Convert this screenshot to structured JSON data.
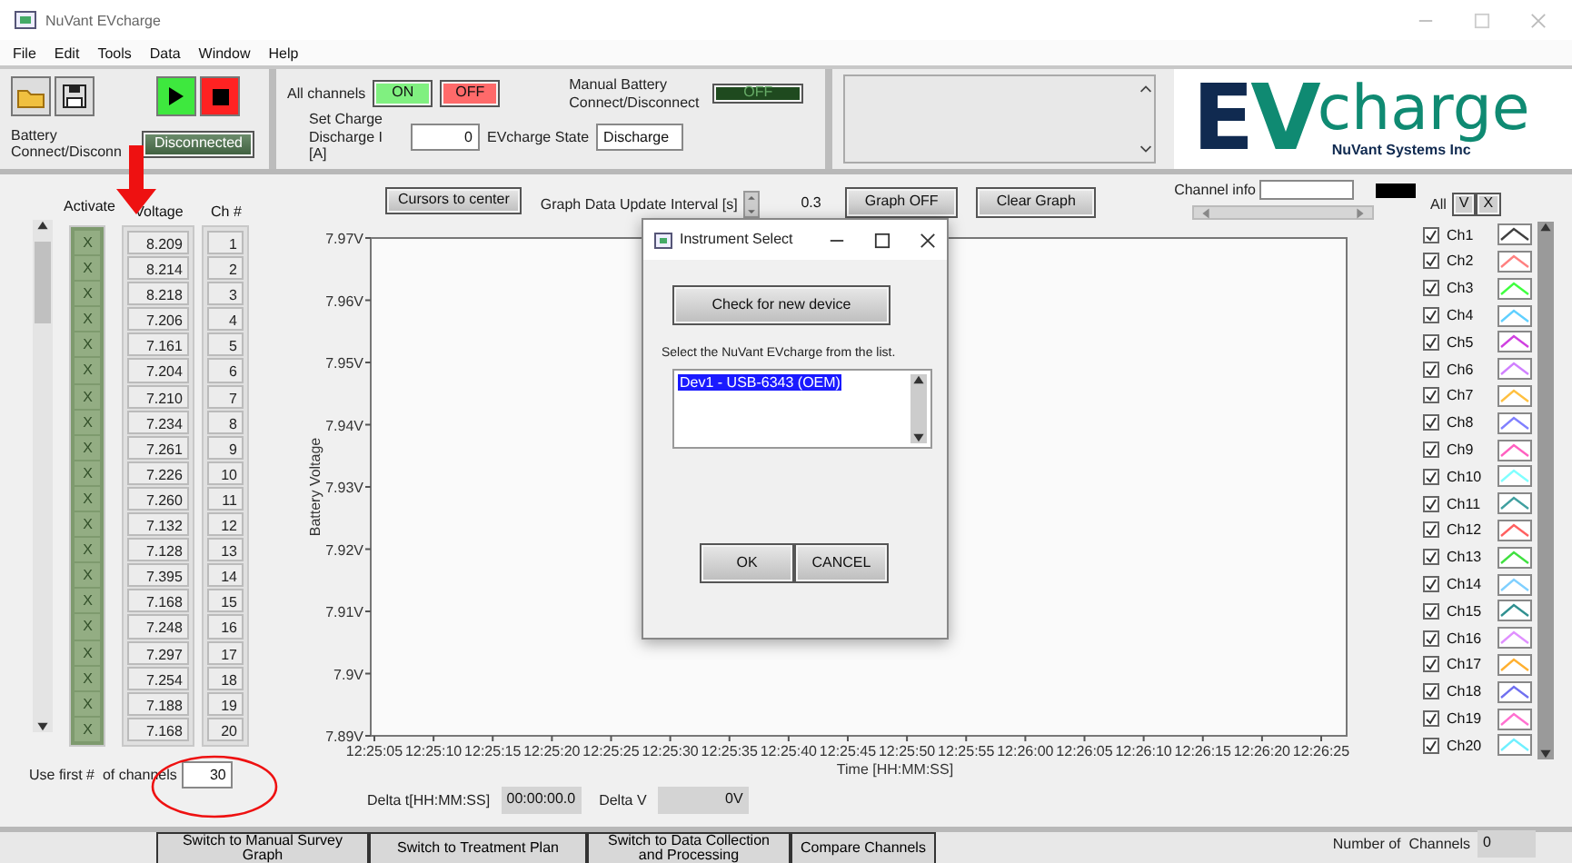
{
  "window": {
    "title": "NuVant EVcharge"
  },
  "menu": [
    "File",
    "Edit",
    "Tools",
    "Data",
    "Window",
    "Help"
  ],
  "toolbar": {
    "battery_label": "Battery Connect/Disconn",
    "connection_button": "Disconnected",
    "all_channels_label": "All channels",
    "on_button": "ON",
    "off_button": "OFF",
    "manual_label": "Manual Battery Connect/Disconnect",
    "manual_toggle": {
      "label": "OFF",
      "on": false
    },
    "charge_label": "Set Charge Discharge I [A]",
    "charge_value": "0",
    "state_label": "EVcharge State",
    "state_value": "Discharge"
  },
  "logo": {
    "parts": [
      {
        "kind": "initial",
        "text": "E",
        "color": "#102a50"
      },
      {
        "kind": "initial",
        "text": "V",
        "color": "#0f8a72"
      },
      {
        "kind": "word",
        "text": "charge",
        "color": "#0f8a72"
      }
    ],
    "subtitle": "NuVant Systems Inc"
  },
  "channel_table": {
    "columns": [
      "Activate",
      "Voltage",
      "Ch #"
    ],
    "rows": [
      {
        "activate": "X",
        "voltage": "8.209",
        "ch": "1"
      },
      {
        "activate": "X",
        "voltage": "8.214",
        "ch": "2"
      },
      {
        "activate": "X",
        "voltage": "8.218",
        "ch": "3"
      },
      {
        "activate": "X",
        "voltage": "7.206",
        "ch": "4"
      },
      {
        "activate": "X",
        "voltage": "7.161",
        "ch": "5"
      },
      {
        "activate": "X",
        "voltage": "7.204",
        "ch": "6"
      },
      {
        "activate": "X",
        "voltage": "7.210",
        "ch": "7"
      },
      {
        "activate": "X",
        "voltage": "7.234",
        "ch": "8"
      },
      {
        "activate": "X",
        "voltage": "7.261",
        "ch": "9"
      },
      {
        "activate": "X",
        "voltage": "7.226",
        "ch": "10"
      },
      {
        "activate": "X",
        "voltage": "7.260",
        "ch": "11"
      },
      {
        "activate": "X",
        "voltage": "7.132",
        "ch": "12"
      },
      {
        "activate": "X",
        "voltage": "7.128",
        "ch": "13"
      },
      {
        "activate": "X",
        "voltage": "7.395",
        "ch": "14"
      },
      {
        "activate": "X",
        "voltage": "7.168",
        "ch": "15"
      },
      {
        "activate": "X",
        "voltage": "7.248",
        "ch": "16"
      },
      {
        "activate": "X",
        "voltage": "7.297",
        "ch": "17"
      },
      {
        "activate": "X",
        "voltage": "7.254",
        "ch": "18"
      },
      {
        "activate": "X",
        "voltage": "7.188",
        "ch": "19"
      },
      {
        "activate": "X",
        "voltage": "7.168",
        "ch": "20"
      }
    ],
    "use_first_label": "Use first #  of channels",
    "use_first_value": "30"
  },
  "graph_controls": {
    "cursors_button": "Cursors to center",
    "interval_label": "Graph Data Update Interval [s]",
    "interval_value": "0.3",
    "graph_off_button": "Graph OFF",
    "clear_graph_button": "Clear Graph",
    "channel_info_label": "Channel info"
  },
  "chart": {
    "chart_data": {
      "type": "line",
      "xlabel": "Time [HH:MM:SS]",
      "ylabel": "Battery Voltage",
      "ylim": [
        7.89,
        7.97
      ],
      "yticks": [
        {
          "value": 7.89,
          "label": "7.89V"
        },
        {
          "value": 7.9,
          "label": "7.9V"
        },
        {
          "value": 7.91,
          "label": "7.91V"
        },
        {
          "value": 7.92,
          "label": "7.92V"
        },
        {
          "value": 7.93,
          "label": "7.93V"
        },
        {
          "value": 7.94,
          "label": "7.94V"
        },
        {
          "value": 7.95,
          "label": "7.95V"
        },
        {
          "value": 7.96,
          "label": "7.96V"
        },
        {
          "value": 7.97,
          "label": "7.97V"
        }
      ],
      "categories": [
        "12:25:05",
        "12:25:10",
        "12:25:15",
        "12:25:20",
        "12:25:25",
        "12:25:30",
        "12:25:35",
        "12:25:40",
        "12:25:45",
        "12:25:50",
        "12:25:55",
        "12:26:00",
        "12:26:05",
        "12:26:10",
        "12:26:15",
        "12:26:20",
        "12:26:25"
      ]
    }
  },
  "delta": {
    "dt_label": "Delta t[HH:MM:SS]",
    "dt_value": "00:00:00.0",
    "dv_label": "Delta V",
    "dv_value": "0V"
  },
  "legend": {
    "all_label": "All",
    "v_button": "V",
    "x_button": "X",
    "channels": [
      {
        "name": "Ch1",
        "checked": true,
        "color": "#404040"
      },
      {
        "name": "Ch2",
        "checked": true,
        "color": "#ff8080"
      },
      {
        "name": "Ch3",
        "checked": true,
        "color": "#40ff40"
      },
      {
        "name": "Ch4",
        "checked": true,
        "color": "#60d0ff"
      },
      {
        "name": "Ch5",
        "checked": true,
        "color": "#d040e0"
      },
      {
        "name": "Ch6",
        "checked": true,
        "color": "#d080ff"
      },
      {
        "name": "Ch7",
        "checked": true,
        "color": "#ffc040"
      },
      {
        "name": "Ch8",
        "checked": true,
        "color": "#8080ff"
      },
      {
        "name": "Ch9",
        "checked": true,
        "color": "#ff60c0"
      },
      {
        "name": "Ch10",
        "checked": true,
        "color": "#80ffff"
      },
      {
        "name": "Ch11",
        "checked": true,
        "color": "#40a0a0"
      },
      {
        "name": "Ch12",
        "checked": true,
        "color": "#ff6060"
      },
      {
        "name": "Ch13",
        "checked": true,
        "color": "#40e040"
      },
      {
        "name": "Ch14",
        "checked": true,
        "color": "#80d0ff"
      },
      {
        "name": "Ch15",
        "checked": true,
        "color": "#309090"
      },
      {
        "name": "Ch16",
        "checked": true,
        "color": "#e090ff"
      },
      {
        "name": "Ch17",
        "checked": true,
        "color": "#ffb030"
      },
      {
        "name": "Ch18",
        "checked": true,
        "color": "#7070f0"
      },
      {
        "name": "Ch19",
        "checked": true,
        "color": "#ff70d0"
      },
      {
        "name": "Ch20",
        "checked": true,
        "color": "#70f0ff"
      }
    ]
  },
  "pages": [
    "Switch to Manual  Survey Graph",
    "Switch to Treatment Plan",
    "Switch to Data Collection and Processing",
    "Compare  Channels"
  ],
  "number_of_channels": {
    "label": "Number of  Channels",
    "value": "0"
  },
  "dialog": {
    "title": "Instrument Select",
    "check_button": "Check for new device",
    "prompt": "Select the NuVant EVcharge from the list.",
    "devices": [
      {
        "name": "Dev1 -  USB-6343 (OEM)",
        "selected": true
      }
    ],
    "ok_button": "OK",
    "cancel_button": "CANCEL"
  },
  "annotations": {
    "red_arrow": true,
    "red_circle": true
  }
}
